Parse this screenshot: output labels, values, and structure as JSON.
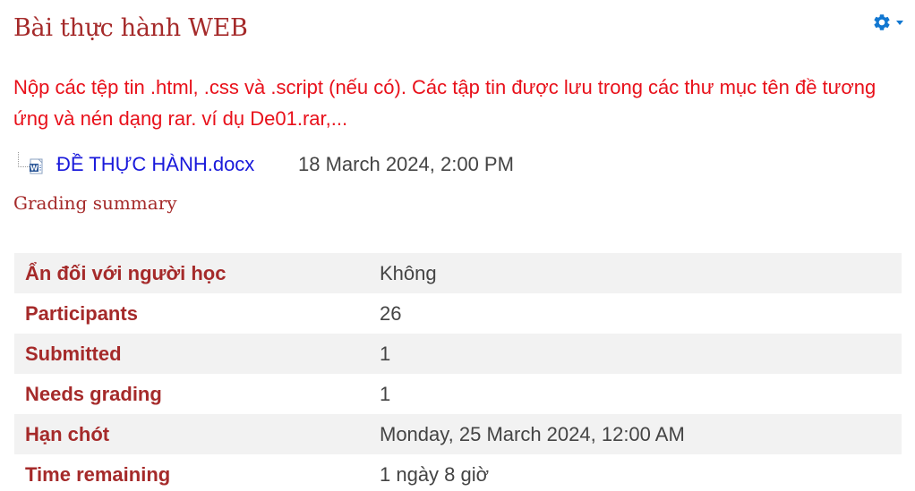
{
  "header": {
    "title": "Bài thực hành WEB",
    "settings_icon": "gear-icon"
  },
  "intro": {
    "text": "Nộp các tệp tin .html, .css và .script (nếu có). Các tập tin được lưu trong các thư mục tên đề tương ứng và nén dạng rar. ví dụ De01.rar,..."
  },
  "attachment": {
    "icon": "word-document-icon",
    "filename": "ĐỀ THỰC HÀNH.docx",
    "date": "18 March 2024, 2:00 PM"
  },
  "grading_summary": {
    "heading": "Grading summary",
    "rows": [
      {
        "label": "Ẩn đối với người học",
        "value": "Không"
      },
      {
        "label": "Participants",
        "value": "26"
      },
      {
        "label": "Submitted",
        "value": "1"
      },
      {
        "label": "Needs grading",
        "value": "1"
      },
      {
        "label": "Hạn chót",
        "value": "Monday, 25 March 2024, 12:00 AM"
      },
      {
        "label": "Time remaining",
        "value": "1 ngày 8 giờ"
      }
    ]
  },
  "colors": {
    "title": "#a52a2a",
    "intro_text": "#e8101a",
    "link": "#1a1adb",
    "gear": "#1177d1",
    "row_stripe": "#f2f2f2"
  }
}
